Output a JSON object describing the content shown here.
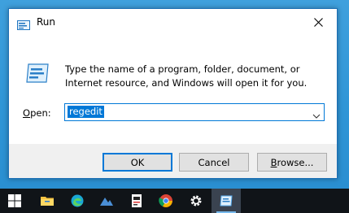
{
  "dialog": {
    "title": "Run",
    "description": "Type the name of a program, folder, document, or Internet resource, and Windows will open it for you.",
    "open_label_prefix": "O",
    "open_label_rest": "pen:",
    "open_value": "regedit"
  },
  "buttons": {
    "ok": "OK",
    "cancel": "Cancel",
    "browse_prefix": "B",
    "browse_rest": "rowse..."
  },
  "taskbar": {
    "icons": [
      "windows-start-icon",
      "file-explorer-icon",
      "edge-icon",
      "photos-icon",
      "terminal-icon",
      "chrome-icon",
      "settings-icon",
      "run-icon"
    ]
  },
  "colors": {
    "accent": "#0078d7",
    "desktop": "#2f95d6",
    "taskbar": "#101418"
  }
}
